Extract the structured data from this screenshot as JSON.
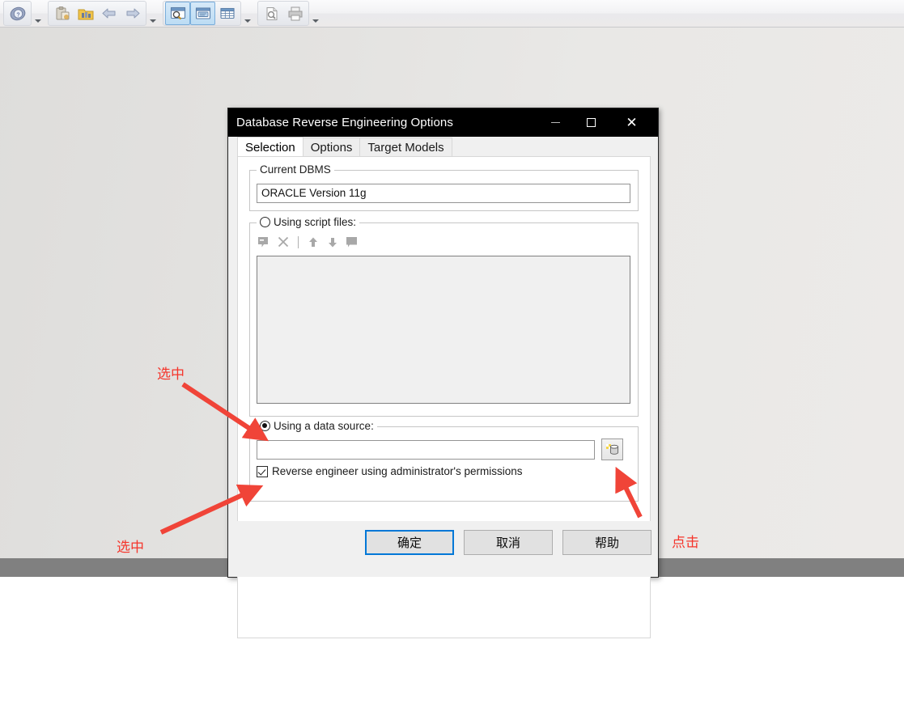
{
  "toolbar": {
    "groups": [
      {
        "buttons": [
          {
            "icon": "help-about-icon",
            "active": false
          }
        ],
        "has_dropdown": true
      },
      {
        "buttons": [
          {
            "icon": "paste-clipboard-icon",
            "active": false
          },
          {
            "icon": "folder-tools-icon",
            "active": false
          },
          {
            "icon": "undo-arrow-icon",
            "active": false
          },
          {
            "icon": "redo-arrow-icon",
            "active": false
          }
        ],
        "has_dropdown": true
      },
      {
        "buttons": [
          {
            "icon": "browser-window-search-icon",
            "active": true
          },
          {
            "icon": "comment-window-icon",
            "active": true
          },
          {
            "icon": "grid-table-window-icon",
            "active": false
          }
        ],
        "has_dropdown": true
      },
      {
        "buttons": [
          {
            "icon": "print-preview-icon",
            "active": false
          },
          {
            "icon": "printer-icon",
            "active": false
          }
        ],
        "has_dropdown": true
      }
    ]
  },
  "dialog": {
    "title": "Database Reverse Engineering Options",
    "window_buttons": {
      "minimize": "minimize-icon",
      "maximize": "maximize-icon",
      "close": "close-icon"
    },
    "tabs": [
      {
        "label": "Selection",
        "selected": true
      },
      {
        "label": "Options",
        "selected": false
      },
      {
        "label": "Target Models",
        "selected": false
      }
    ],
    "current_dbms": {
      "legend": "Current DBMS",
      "value": "ORACLE Version 11g"
    },
    "script_files": {
      "legend": "Using script files:",
      "radio_checked": false,
      "toolbar_icons": [
        "add-script-file-icon",
        "delete-script-file-icon",
        "separator",
        "move-up-icon",
        "move-down-icon",
        "edit-script-file-icon"
      ],
      "list_items": []
    },
    "data_source": {
      "legend": "Using a data source:",
      "radio_checked": true,
      "input_value": "",
      "input_placeholder": "",
      "browse_icon": "database-cylinder-icon",
      "checkbox": {
        "label": "Reverse engineer using administrator's permissions",
        "checked": true
      }
    },
    "buttons": [
      {
        "label": "确定",
        "name": "ok-button",
        "default": true
      },
      {
        "label": "取消",
        "name": "cancel-button",
        "default": false
      },
      {
        "label": "帮助",
        "name": "help-button",
        "default": false
      }
    ]
  },
  "annotations": [
    {
      "text": "选中",
      "name": "annotation-select-datasource"
    },
    {
      "text": "选中",
      "name": "annotation-select-checkbox"
    },
    {
      "text": "点击",
      "name": "annotation-click-browse"
    }
  ],
  "colors": {
    "annotation_red": "#f5352b",
    "titlebar_black": "#000000",
    "default_button_blue": "#0078d7",
    "desktop_gray": "#808080"
  }
}
